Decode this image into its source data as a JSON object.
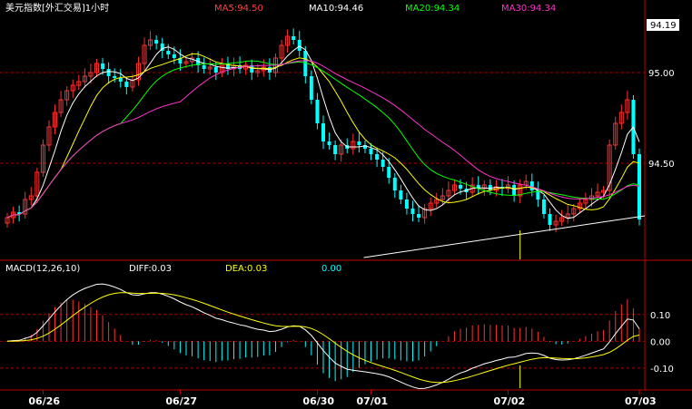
{
  "header": {
    "title": "美元指数[外汇交易]1小时",
    "ma5": "MA5:94.50",
    "ma10": "MA10:94.46",
    "ma20": "MA20:94.34",
    "ma30": "MA30:94.34"
  },
  "price_tag": "94.19",
  "macd_header": {
    "label": "MACD(12,26,10)",
    "diff": "DIFF:0.03",
    "dea": "DEA:0.03",
    "macd": "0.00"
  },
  "colors": {
    "bg": "#000000",
    "up": "#FF3030",
    "down": "#00FFFF",
    "ma5": "#FFFFFF",
    "ma10": "#FFFF00",
    "ma20": "#00FF00",
    "ma30": "#FF33CC",
    "grid": "#A00000",
    "axis": "#C00000",
    "text_title": "#FFFFFF",
    "text_ma5": "#FF4040",
    "text_ma10": "#FFFFFF",
    "text_ma20": "#00FF00",
    "text_ma30": "#FF33CC",
    "date_text": "#FFFFFF",
    "tag_bg": "#FFFFFF",
    "tag_text": "#000000"
  },
  "chart_data": [
    {
      "type": "candlestick",
      "title": "美元指数[外汇交易]1小时",
      "y_ticks": [
        "95.00",
        "94.50"
      ],
      "y_tick_values": [
        95.0,
        94.5
      ],
      "ylim": [
        93.97,
        95.31
      ],
      "x_tick_labels": [
        "06/26",
        "06/27",
        "06/30",
        "07/01",
        "07/02",
        "07/03"
      ],
      "x_tick_index": [
        6,
        29,
        52,
        61,
        84,
        106
      ],
      "grid": true,
      "legend": "top",
      "series_names": [
        "MA5",
        "MA10",
        "MA20",
        "MA30"
      ],
      "candles_close": [
        94.2,
        94.23,
        94.22,
        94.3,
        94.32,
        94.45,
        94.6,
        94.7,
        94.78,
        94.85,
        94.9,
        94.93,
        94.95,
        94.98,
        95.0,
        95.05,
        95.02,
        94.98,
        94.97,
        94.95,
        94.92,
        94.96,
        95.05,
        95.15,
        95.18,
        95.16,
        95.12,
        95.1,
        95.08,
        95.05,
        95.06,
        95.08,
        95.04,
        95.02,
        95.03,
        95.0,
        95.05,
        95.02,
        95.04,
        95.02,
        95.04,
        95.0,
        95.01,
        95.03,
        95.0,
        95.08,
        95.15,
        95.2,
        95.18,
        95.12,
        94.98,
        94.85,
        94.72,
        94.62,
        94.6,
        94.55,
        94.6,
        94.58,
        94.62,
        94.6,
        94.58,
        94.55,
        94.52,
        94.48,
        94.42,
        94.35,
        94.3,
        94.25,
        94.22,
        94.2,
        94.25,
        94.28,
        94.3,
        94.32,
        94.35,
        94.38,
        94.36,
        94.34,
        94.38,
        94.36,
        94.38,
        94.35,
        94.37,
        94.36,
        94.38,
        94.32,
        94.38,
        94.4,
        94.35,
        94.3,
        94.22,
        94.16,
        94.18,
        94.2,
        94.22,
        94.25,
        94.28,
        94.3,
        94.32,
        94.34,
        94.35,
        94.6,
        94.72,
        94.78,
        94.85,
        94.55,
        94.19
      ],
      "ma5_last": 94.5,
      "ma10_last": 94.46,
      "ma20_last": 94.34,
      "ma30_last": 94.34
    },
    {
      "type": "macd",
      "title": "MACD(12,26,10)",
      "y_ticks": [
        "0.10",
        "0.00",
        "-0.10"
      ],
      "y_tick_values": [
        0.1,
        0.0,
        -0.1
      ],
      "ylim": [
        -0.175,
        0.245
      ],
      "diff_last": 0.03,
      "dea_last": 0.03,
      "macd_last": 0.0
    }
  ]
}
